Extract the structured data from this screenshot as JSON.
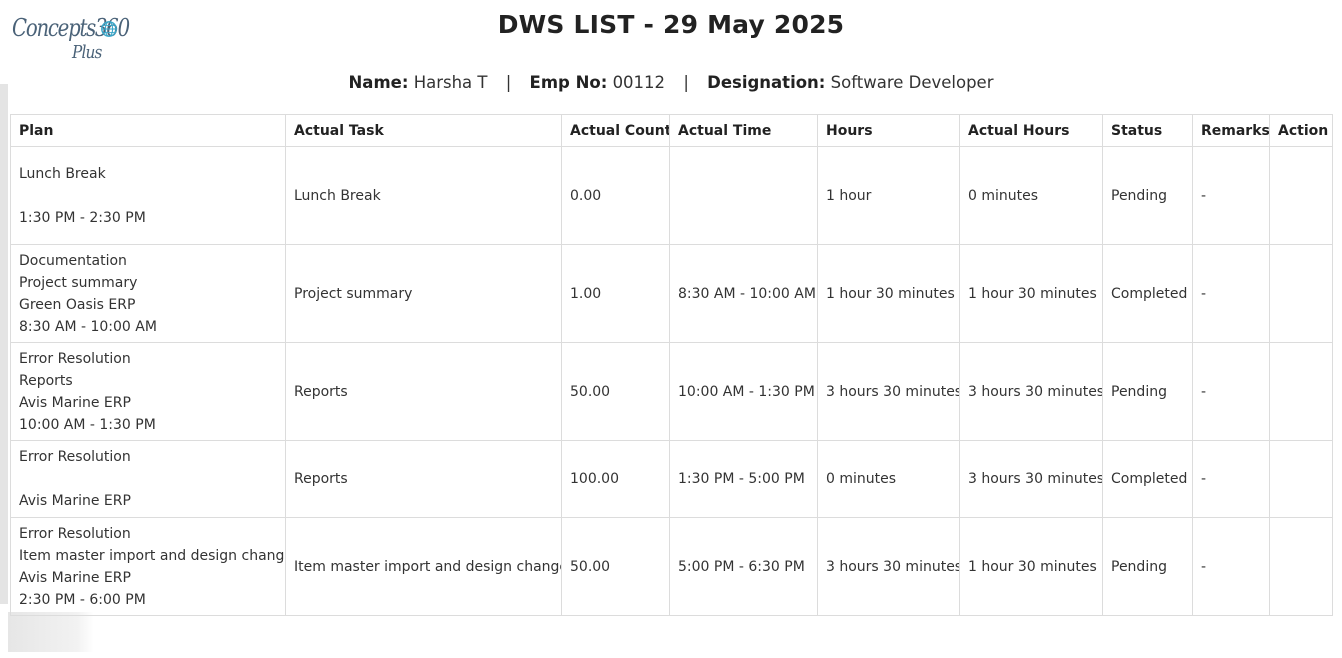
{
  "logo": {
    "word": "Concepts360",
    "plus": "Plus"
  },
  "title": "DWS LIST - 29 May 2025",
  "employee": {
    "name_label": "Name:",
    "name": "Harsha T",
    "emp_no_label": "Emp No:",
    "emp_no": "00112",
    "designation_label": "Designation:",
    "designation": "Software Developer",
    "separator": "|"
  },
  "table": {
    "columns": [
      "Plan",
      "Actual Task",
      "Actual Count",
      "Actual Time",
      "Hours",
      "Actual Hours",
      "Status",
      "Remarks",
      "Action"
    ],
    "rows": [
      {
        "plan": [
          "Lunch Break",
          "",
          "1:30 PM - 2:30 PM"
        ],
        "actual_task": "Lunch Break",
        "actual_count": "0.00",
        "actual_time": "",
        "hours": "1 hour",
        "actual_hours": "0 minutes",
        "status": "Pending",
        "remarks": "-",
        "action": ""
      },
      {
        "plan": [
          "Documentation",
          "Project summary",
          "Green Oasis ERP",
          "8:30 AM - 10:00 AM"
        ],
        "actual_task": "Project summary",
        "actual_count": "1.00",
        "actual_time": "8:30 AM - 10:00 AM",
        "hours": "1 hour 30 minutes",
        "actual_hours": "1 hour 30 minutes",
        "status": "Completed",
        "remarks": "-",
        "action": ""
      },
      {
        "plan": [
          "Error Resolution",
          "Reports",
          "Avis Marine ERP",
          "10:00 AM - 1:30 PM"
        ],
        "actual_task": "Reports",
        "actual_count": "50.00",
        "actual_time": "10:00 AM - 1:30 PM",
        "hours": "3 hours 30 minutes",
        "actual_hours": "3 hours 30 minutes",
        "status": "Pending",
        "remarks": "-",
        "action": ""
      },
      {
        "plan": [
          "Error Resolution",
          "",
          "Avis Marine ERP"
        ],
        "actual_task": "Reports",
        "actual_count": "100.00",
        "actual_time": "1:30 PM - 5:00 PM",
        "hours": "0 minutes",
        "actual_hours": "3 hours 30 minutes",
        "status": "Completed",
        "remarks": "-",
        "action": ""
      },
      {
        "plan": [
          "Error Resolution",
          "Item master import and design changes",
          "Avis Marine ERP",
          "2:30 PM - 6:00 PM"
        ],
        "actual_task": "Item master import and design changes",
        "actual_count": "50.00",
        "actual_time": "5:00 PM - 6:30 PM",
        "hours": "3 hours 30 minutes",
        "actual_hours": "1 hour 30 minutes",
        "status": "Pending",
        "remarks": "-",
        "action": ""
      }
    ]
  }
}
